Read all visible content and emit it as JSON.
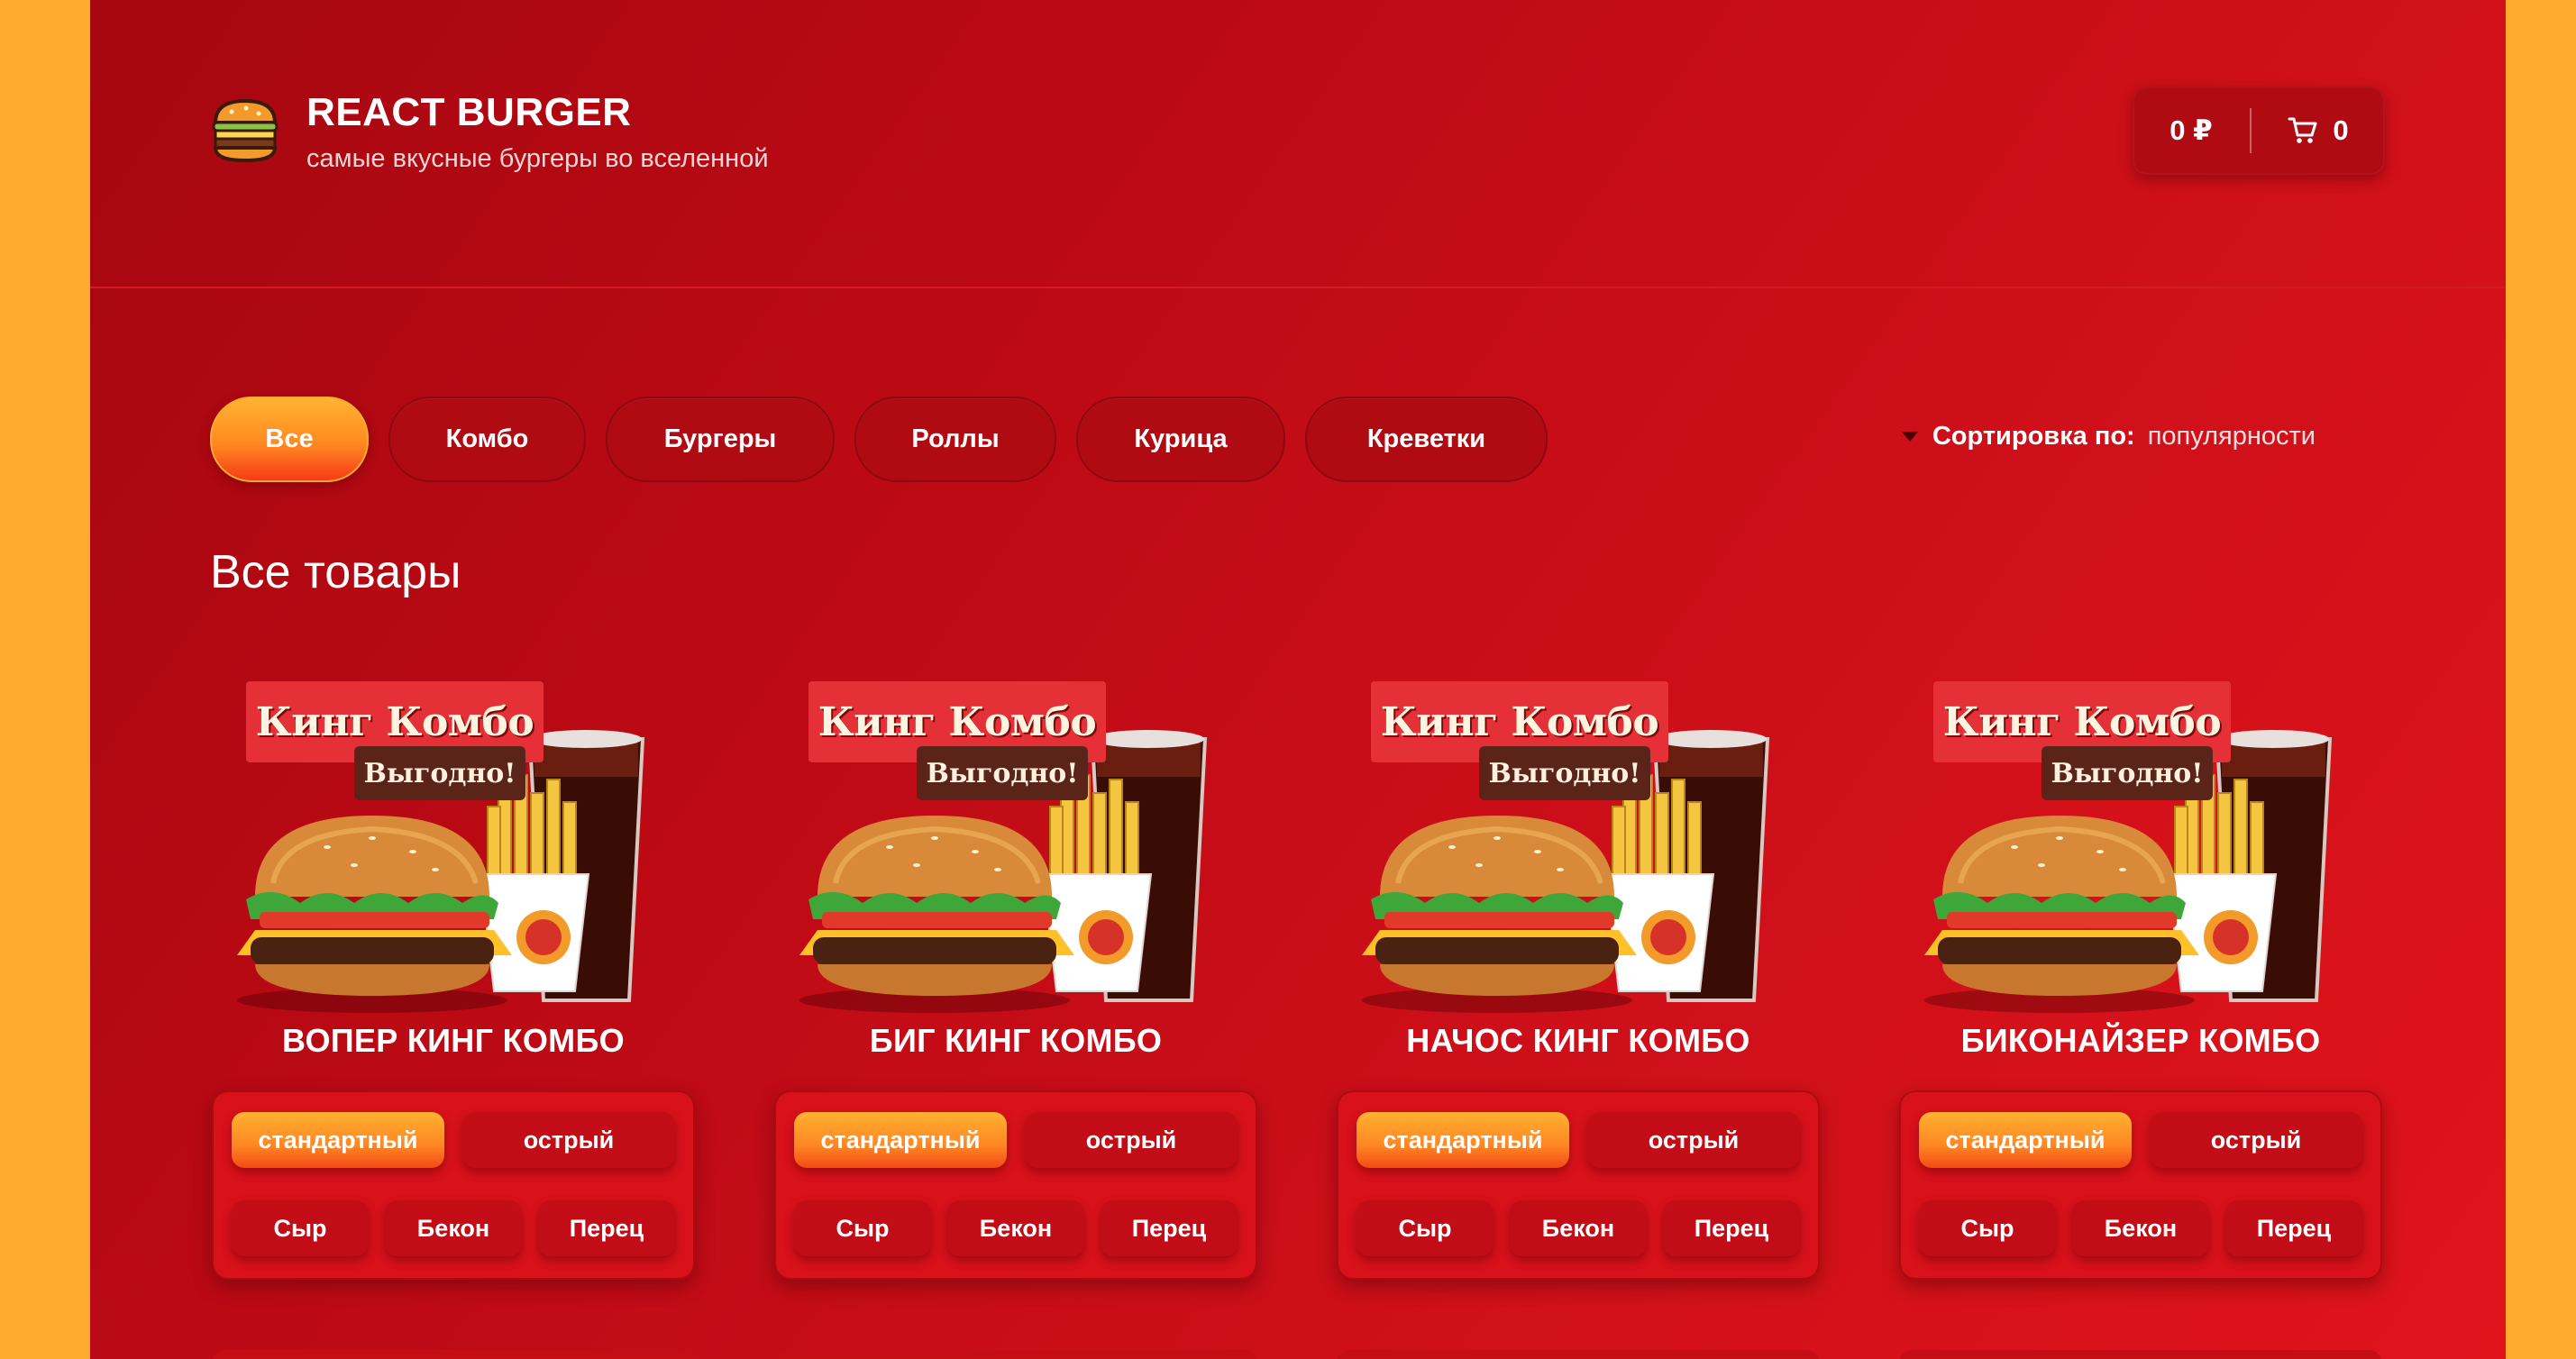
{
  "brand": {
    "title": "REACT BURGER",
    "subtitle": "самые вкусные бургеры во вселенной",
    "logo_icon": "burger-icon"
  },
  "cart": {
    "price": "0 ₽",
    "count": "0",
    "icon": "cart-icon"
  },
  "categories": [
    {
      "label": "Все",
      "active": true
    },
    {
      "label": "Комбо",
      "active": false
    },
    {
      "label": "Бургеры",
      "active": false
    },
    {
      "label": "Роллы",
      "active": false
    },
    {
      "label": "Курица",
      "active": false
    },
    {
      "label": "Креветки",
      "active": false
    }
  ],
  "sort": {
    "label": "Сортировка по:",
    "value": "популярности"
  },
  "section_title": "Все товары",
  "products": [
    {
      "name": "ВОПЕР КИНГ КОМБО",
      "badge_text": "Кинг Комбо",
      "deal_text": "Выгодно!",
      "types": [
        {
          "label": "стандартный",
          "active": true
        },
        {
          "label": "острый",
          "active": false
        }
      ],
      "addons": [
        "Сыр",
        "Бекон",
        "Перец"
      ]
    },
    {
      "name": "БИГ КИНГ КОМБО",
      "badge_text": "Кинг Комбо",
      "deal_text": "Выгодно!",
      "types": [
        {
          "label": "стандартный",
          "active": true
        },
        {
          "label": "острый",
          "active": false
        }
      ],
      "addons": [
        "Сыр",
        "Бекон",
        "Перец"
      ]
    },
    {
      "name": "НАЧОС КИНГ КОМБО",
      "badge_text": "Кинг Комбо",
      "deal_text": "Выгодно!",
      "types": [
        {
          "label": "стандартный",
          "active": true
        },
        {
          "label": "острый",
          "active": false
        }
      ],
      "addons": [
        "Сыр",
        "Бекон",
        "Перец"
      ]
    },
    {
      "name": "БИКОНАЙЗЕР КОМБО",
      "badge_text": "Кинг Комбо",
      "deal_text": "Выгодно!",
      "types": [
        {
          "label": "стандартный",
          "active": true
        },
        {
          "label": "острый",
          "active": false
        }
      ],
      "addons": [
        "Сыр",
        "Бекон",
        "Перец"
      ]
    }
  ],
  "colors": {
    "page_bg": "#ffab2d",
    "panel_red": "#c00b15",
    "accent_orange": "#ff9a26"
  }
}
